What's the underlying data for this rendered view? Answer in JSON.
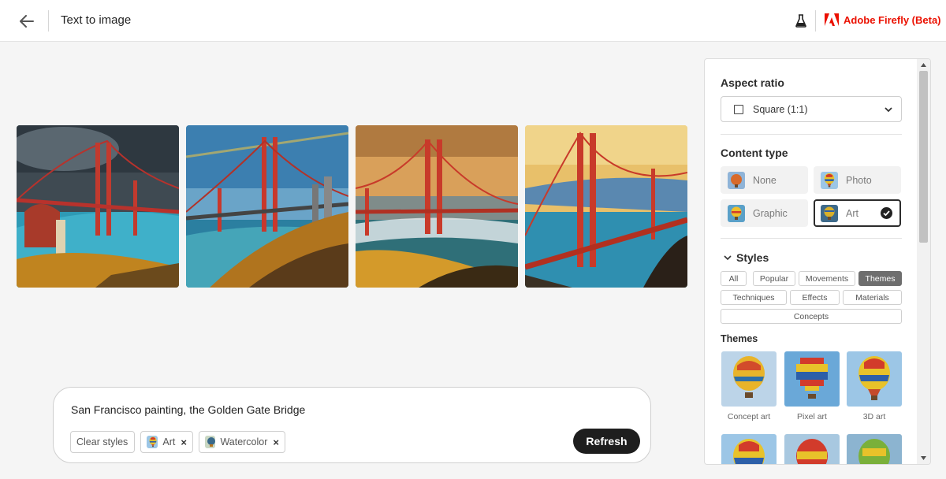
{
  "header": {
    "title": "Text to image",
    "brand_name": "Adobe Firefly (Beta)",
    "back_icon": "arrow-left-icon",
    "labs_icon": "beaker-icon"
  },
  "gallery": {
    "images": [
      {
        "name": "generated-image-1"
      },
      {
        "name": "generated-image-2"
      },
      {
        "name": "generated-image-3"
      },
      {
        "name": "generated-image-4"
      }
    ]
  },
  "prompt": {
    "text": "San Francisco painting, the Golden Gate Bridge",
    "clear_styles_label": "Clear styles",
    "chips": [
      {
        "label": "Art"
      },
      {
        "label": "Watercolor"
      }
    ],
    "refresh_label": "Refresh"
  },
  "panel": {
    "aspect_ratio": {
      "title": "Aspect ratio",
      "selected": "Square (1:1)"
    },
    "content_type": {
      "title": "Content type",
      "options": [
        {
          "label": "None",
          "selected": false
        },
        {
          "label": "Photo",
          "selected": false
        },
        {
          "label": "Graphic",
          "selected": false
        },
        {
          "label": "Art",
          "selected": true
        }
      ]
    },
    "styles": {
      "title": "Styles",
      "tabs": [
        {
          "label": "All",
          "active": false
        },
        {
          "label": "Popular",
          "active": false
        },
        {
          "label": "Movements",
          "active": false
        },
        {
          "label": "Themes",
          "active": true
        },
        {
          "label": "Techniques",
          "active": false
        },
        {
          "label": "Effects",
          "active": false
        },
        {
          "label": "Materials",
          "active": false
        },
        {
          "label": "Concepts",
          "active": false
        }
      ],
      "section_title": "Themes",
      "themes": [
        {
          "label": "Concept art"
        },
        {
          "label": "Pixel art"
        },
        {
          "label": "3D art"
        }
      ]
    }
  },
  "colors": {
    "brand": "#eb1000",
    "refresh_bg": "#1e1e1e",
    "active_tab": "#6e6e6e"
  }
}
